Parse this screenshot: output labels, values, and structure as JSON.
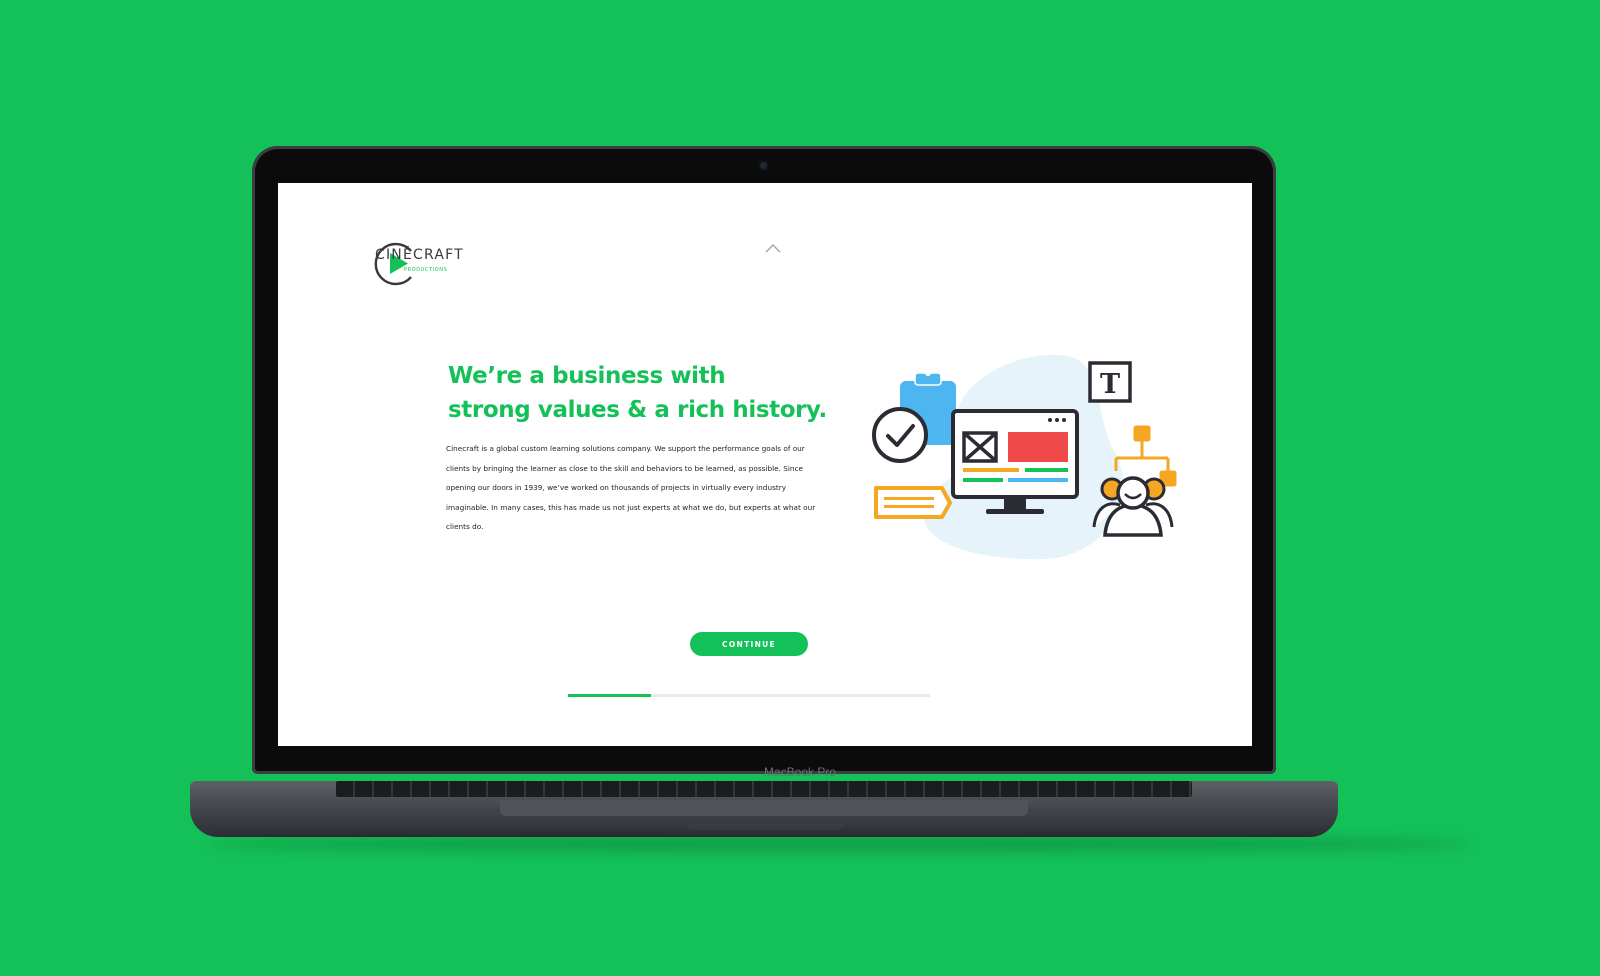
{
  "brand": {
    "name": "CINÉCRAFT",
    "subtitle": "PRODUCTIONS",
    "accent_color": "#14c158"
  },
  "hero": {
    "headline_line1": "We’re a business with",
    "headline_line2": "strong values & a rich history.",
    "body": "Cinecraft is a global custom learning solutions company. We support the performance goals of our clients by bringing the learner as close to the skill and behaviors to be learned, as possible. Since opening our doors in 1939, we’ve worked on thousands of projects in virtually every industry imaginable. In many cases, this has made us not just experts at what we do, but experts at what our clients do."
  },
  "actions": {
    "continue_label": "CONTINUE"
  },
  "progress": {
    "fraction": 0.23
  },
  "device": {
    "label": "MacBook Pro"
  },
  "icons": [
    "play-logo-icon",
    "chevron-up-icon",
    "clipboard-icon",
    "checkmark-icon",
    "monitor-icon",
    "image-placeholder-icon",
    "text-icon",
    "org-chart-icon",
    "users-icon",
    "chat-bubble-icon"
  ]
}
